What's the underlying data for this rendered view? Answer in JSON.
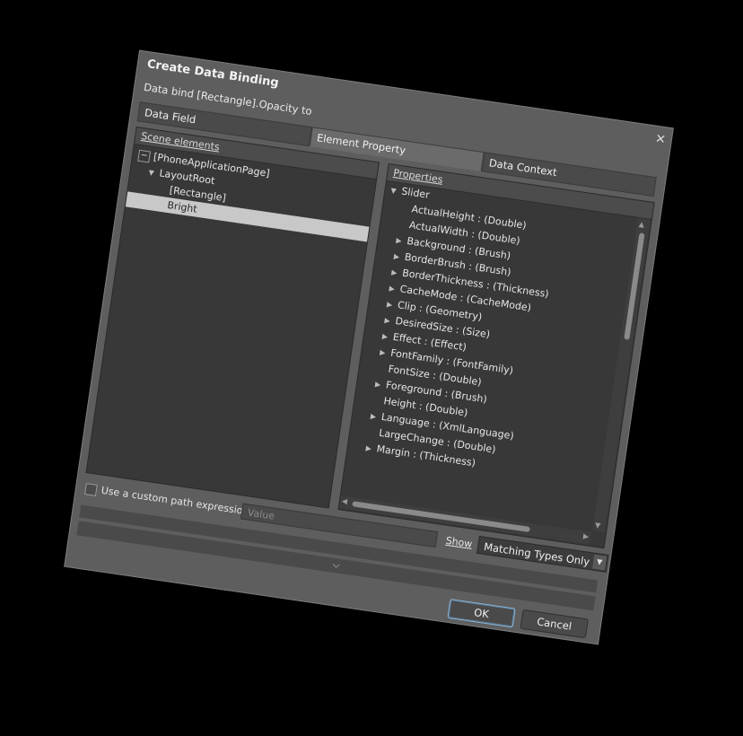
{
  "dialog": {
    "title": "Create Data Binding",
    "subtitle": "Data bind [Rectangle].Opacity to",
    "close_glyph": "✕"
  },
  "tabs": [
    {
      "label": "Data Field",
      "active": false
    },
    {
      "label": "Element Property",
      "active": true
    },
    {
      "label": "Data Context",
      "active": false
    }
  ],
  "scene": {
    "header": "Scene elements",
    "items": [
      {
        "label": "[PhoneApplicationPage]",
        "depth": 0,
        "glyph": "−"
      },
      {
        "label": "LayoutRoot",
        "depth": 1,
        "glyph": "▼"
      },
      {
        "label": "[Rectangle]",
        "depth": 2,
        "glyph": ""
      },
      {
        "label": "Bright",
        "depth": 2,
        "glyph": "",
        "selected": true
      }
    ]
  },
  "properties": {
    "header": "Properties",
    "items": [
      {
        "label": "Slider",
        "depth": 0,
        "glyph": "▼"
      },
      {
        "label": "ActualHeight : (Double)",
        "depth": 1,
        "glyph": ""
      },
      {
        "label": "ActualWidth : (Double)",
        "depth": 1,
        "glyph": ""
      },
      {
        "label": "Background : (Brush)",
        "depth": 1,
        "glyph": "▶"
      },
      {
        "label": "BorderBrush : (Brush)",
        "depth": 1,
        "glyph": "▶"
      },
      {
        "label": "BorderThickness : (Thickness)",
        "depth": 1,
        "glyph": "▶"
      },
      {
        "label": "CacheMode : (CacheMode)",
        "depth": 1,
        "glyph": "▶"
      },
      {
        "label": "Clip : (Geometry)",
        "depth": 1,
        "glyph": "▶"
      },
      {
        "label": "DesiredSize : (Size)",
        "depth": 1,
        "glyph": "▶"
      },
      {
        "label": "Effect : (Effect)",
        "depth": 1,
        "glyph": "▶"
      },
      {
        "label": "FontFamily : (FontFamily)",
        "depth": 1,
        "glyph": "▶"
      },
      {
        "label": "FontSize : (Double)",
        "depth": 1,
        "glyph": ""
      },
      {
        "label": "Foreground : (Brush)",
        "depth": 1,
        "glyph": "▶"
      },
      {
        "label": "Height : (Double)",
        "depth": 1,
        "glyph": ""
      },
      {
        "label": "Language : (XmlLanguage)",
        "depth": 1,
        "glyph": "▶"
      },
      {
        "label": "LargeChange : (Double)",
        "depth": 1,
        "glyph": ""
      },
      {
        "label": "Margin : (Thickness)",
        "depth": 1,
        "glyph": "▶"
      }
    ]
  },
  "custom_path": {
    "label": "Use a custom path expression",
    "checked": false,
    "value_placeholder": "Value"
  },
  "show": {
    "label": "Show",
    "selected": "Matching Types Only"
  },
  "expander_glyph": "⌵",
  "buttons": {
    "ok": "OK",
    "cancel": "Cancel"
  },
  "colors": {
    "dialog_bg": "#5e5e5e",
    "panel_bg": "#383838",
    "selection_bg": "#c8c8c8",
    "ok_border": "#8ab4d6"
  }
}
